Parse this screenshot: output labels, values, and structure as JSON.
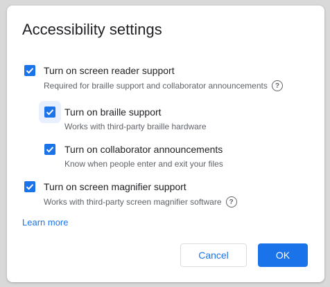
{
  "dialog": {
    "title": "Accessibility settings",
    "accent_color": "#1a73e8"
  },
  "options": [
    {
      "label": "Turn on screen reader support",
      "description": "Required for braille support and collaborator announcements",
      "checked": true,
      "help": true
    },
    {
      "label": "Turn on braille support",
      "description": "Works with third-party braille hardware",
      "checked": true,
      "help": false
    },
    {
      "label": "Turn on collaborator announcements",
      "description": "Know when people enter and exit your files",
      "checked": true,
      "help": false
    },
    {
      "label": "Turn on screen magnifier support",
      "description": "Works with third-party screen magnifier software",
      "checked": true,
      "help": true
    }
  ],
  "help_glyph": "?",
  "learn_more": "Learn more",
  "buttons": {
    "cancel": "Cancel",
    "ok": "OK"
  }
}
